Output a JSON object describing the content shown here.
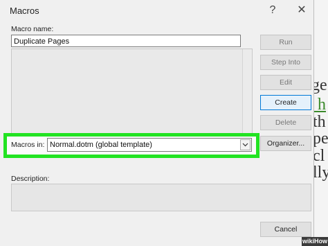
{
  "dialog": {
    "title": "Macros",
    "help_glyph": "?",
    "close_glyph": "✕",
    "macro_name_label": "Macro name:",
    "macro_name_value": "Duplicate Pages",
    "macros_in_label": "Macros in:",
    "macros_in_selected": "Normal.dotm (global template)",
    "description_label": "Description:",
    "buttons": {
      "run": "Run",
      "step_into": "Step Into",
      "edit": "Edit",
      "create": "Create",
      "delete": "Delete",
      "organizer": "Organizer...",
      "cancel": "Cancel"
    }
  },
  "background_doc_fragments": [
    "ge",
    "y h",
    "th",
    "pe",
    "cl",
    "lly"
  ],
  "watermark": "wikiHow",
  "colors": {
    "highlight": "#22e322",
    "focus_border": "#0078d7"
  },
  "icons": {
    "dropdown": "chevron-down-icon"
  }
}
